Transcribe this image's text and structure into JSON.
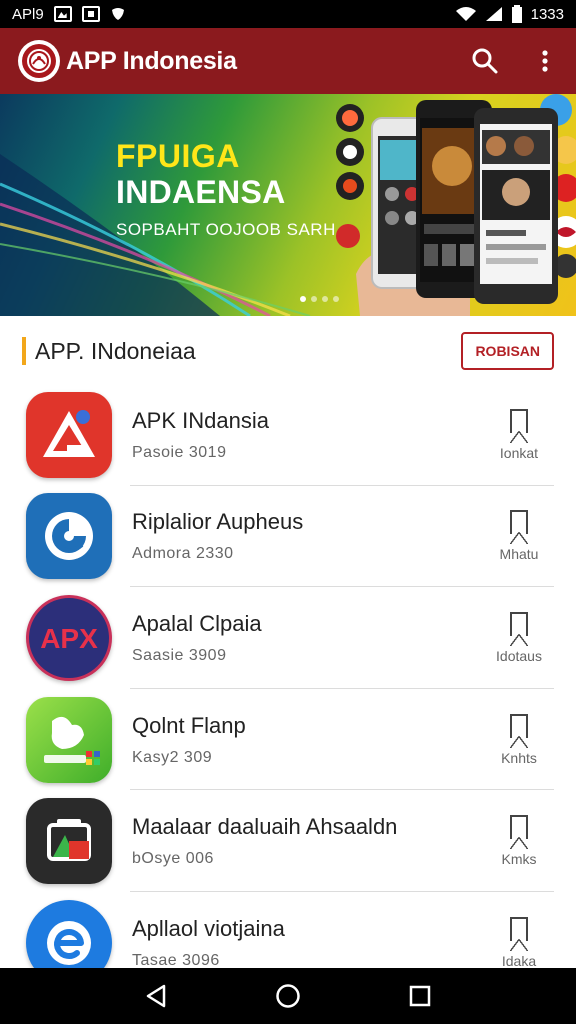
{
  "status_bar": {
    "left_text": "APl9",
    "time": "1333"
  },
  "app_bar": {
    "title": "APP Indonesia",
    "icons": [
      "search-icon",
      "more-vert-icon"
    ],
    "color": "#8b1a1e"
  },
  "banner": {
    "headline1": "FPUIGA",
    "headline2": "INDAENSA",
    "tagline": "SOPBAHT OOJOOB SARH",
    "slides": 4,
    "active_slide": 1
  },
  "section": {
    "title": "APP. INdoneiaa",
    "button_label": "ROBISAN",
    "accent_color": "#f2a71b"
  },
  "apps": [
    {
      "name": "APK INdansia",
      "sub": "Pasoie 3019",
      "right": "Ionkat",
      "icon": "triangle-app-icon"
    },
    {
      "name": "Riplalior Aupheus",
      "sub": "Admora 2330",
      "right": "Mhatu",
      "icon": "swirl-app-icon"
    },
    {
      "name": "Apalal Clpaia",
      "sub": "Saasie 3909",
      "right": "Idotaus",
      "icon": "apx-app-icon"
    },
    {
      "name": "Qolnt Flanp",
      "sub": "Kasy2 309",
      "right": "Knhts",
      "icon": "bird-app-icon"
    },
    {
      "name": "Maalaar daaluaih Ahsaaldn",
      "sub": "bOsye 006",
      "right": "Kmks",
      "icon": "folder-app-icon"
    },
    {
      "name": "Apllaol viotjaina",
      "sub": "Tasae 3096",
      "right": "Idaka",
      "icon": "e-app-icon"
    }
  ]
}
